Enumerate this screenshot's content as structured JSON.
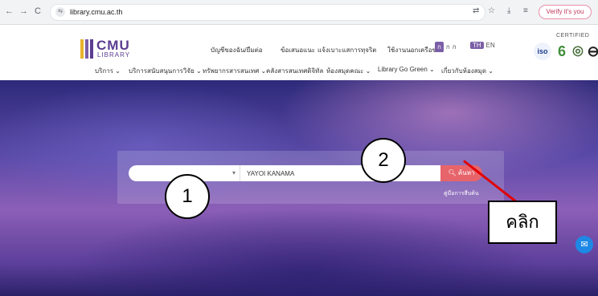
{
  "browser": {
    "url": "library.cmu.ac.th",
    "back_icon": "←",
    "forward_icon": "→",
    "reload_icon": "C",
    "site_icon": "⇆",
    "translate_icon": "⇄",
    "star_icon": "☆",
    "download_icon": "⤓",
    "extensions_icon": "≡",
    "verify_label": "Verify it's you"
  },
  "header": {
    "logo_main": "CMU",
    "logo_sub": "LIBRARY",
    "top_links": [
      "บัญชีของฉัน/ยืมต่อ",
      "ข้อเสนอแนะ",
      "แจ้งเบาะแสการทุจริต",
      "ใช้งานนอกเครือข่าย"
    ],
    "lang_thai_badge": "ก",
    "lang_thai_sub": [
      "ก",
      "ก"
    ],
    "lang_th": "TH",
    "lang_en": "EN",
    "cert_label": "CERTIFIED",
    "cert_items": [
      {
        "name": "iso",
        "glyph": "iso",
        "color": "#1d3f8c"
      },
      {
        "name": "green-6",
        "glyph": "6",
        "color": "#3f8f3a"
      },
      {
        "name": "seal",
        "glyph": "◎",
        "color": "#4a6f3c"
      },
      {
        "name": "badge",
        "glyph": "⊖",
        "color": "#222222"
      }
    ],
    "main_menu": [
      "บริการ",
      "บริการสนับสนุนการวิจัย",
      "ทรัพยากรสารสนเทศ",
      "คลังสารสนเทศดิจิทัล",
      "ห้องสมุดคณะ",
      "Library Go Green",
      "เกี่ยวกับห้องสมุด"
    ]
  },
  "search": {
    "select_value": "",
    "query_value": "YAYOI KANAMA",
    "button_label": "ค้นหา",
    "guide_link": "คู่มือการสืบค้น"
  },
  "annotations": {
    "marker_1": "1",
    "marker_2": "2",
    "click_label": "คลิก"
  },
  "colors": {
    "brand_purple": "#5b3d91",
    "search_button": "#e7646b",
    "annotation_line": "#e20000"
  }
}
